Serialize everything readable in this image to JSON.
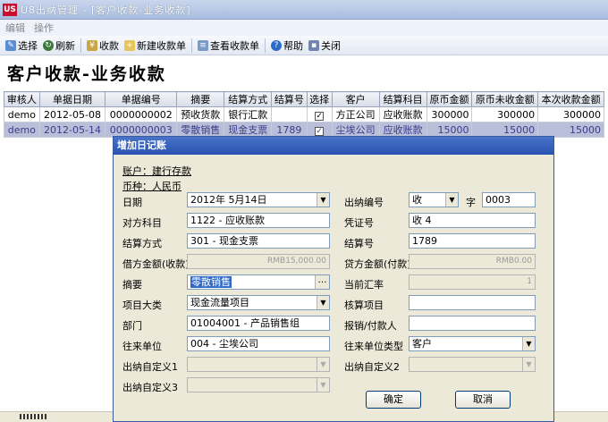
{
  "window": {
    "logo": "US",
    "title": "U8出纳管理 - [客户收款-业务收款]"
  },
  "menu": {
    "edit": "编辑",
    "operate": "操作"
  },
  "toolbar": {
    "select": "选择",
    "refresh": "刷新",
    "receive": "收款",
    "new_receipt": "新建收款单",
    "view_receipt": "查看收款单",
    "help": "帮助",
    "close": "关闭"
  },
  "page": {
    "title": "客户收款-业务收款"
  },
  "table": {
    "headers": [
      "审核人",
      "单据日期",
      "单据编号",
      "摘要",
      "结算方式",
      "结算号",
      "选择",
      "客户",
      "结算科目",
      "原币金额",
      "原币未收金额",
      "本次收款金额"
    ],
    "rows": [
      {
        "auditor": "demo",
        "date": "2012-05-08",
        "number": "0000000002",
        "summary": "预收货款",
        "method": "银行汇款",
        "settle_no": "",
        "checked": "✓",
        "customer": "方正公司",
        "account": "应收账款",
        "amount": "300000",
        "unpaid": "300000",
        "this_amount": "300000"
      },
      {
        "auditor": "demo",
        "date": "2012-05-14",
        "number": "0000000003",
        "summary": "零散销售",
        "method": "现金支票",
        "settle_no": "1789",
        "checked": "✓",
        "customer": "尘埃公司",
        "account": "应收账款",
        "amount": "15000",
        "unpaid": "15000",
        "this_amount": "15000"
      }
    ]
  },
  "dialog": {
    "title": "增加日记账",
    "account_label": "账户：建行存款",
    "currency_label": "币种：人民币",
    "date_label": "日期",
    "date_value": "2012年 5月14日",
    "cashier_no_label": "出纳编号",
    "cashier_type": "收",
    "zi_label": "字",
    "cashier_no": "0003",
    "counter_subject_label": "对方科目",
    "counter_subject": "1122 - 应收账款",
    "voucher_no_label": "凭证号",
    "voucher_no": "收 4",
    "settle_method_label": "结算方式",
    "settle_method": "301 - 现金支票",
    "settle_no_label": "结算号",
    "settle_no": "1789",
    "debit_label": "借方金额(收款)",
    "debit": "RMB15,000.00",
    "credit_label": "贷方金额(付款)",
    "credit": "RMB0.00",
    "summary_label": "摘要",
    "summary": "零散销售",
    "rate_label": "当前汇率",
    "rate": "1",
    "project_class_label": "项目大类",
    "project_class": "现金流量项目",
    "check_item_label": "核算项目",
    "check_item": "",
    "dept_label": "部门",
    "dept": "01004001 - 产品销售组",
    "reimburse_label": "报销/付款人",
    "reimburse": "",
    "partner_label": "往来单位",
    "partner": "004 - 尘埃公司",
    "partner_type_label": "往来单位类型",
    "partner_type": "客户",
    "custom1_label": "出纳自定义1",
    "custom1": "",
    "custom2_label": "出纳自定义2",
    "custom2": "",
    "custom3_label": "出纳自定义3",
    "custom3": "",
    "ok": "确定",
    "cancel": "取消"
  },
  "icons": [
    "select-icon",
    "refresh-icon",
    "receive-icon",
    "new-receipt-icon",
    "view-receipt-icon",
    "help-icon",
    "close-icon"
  ]
}
